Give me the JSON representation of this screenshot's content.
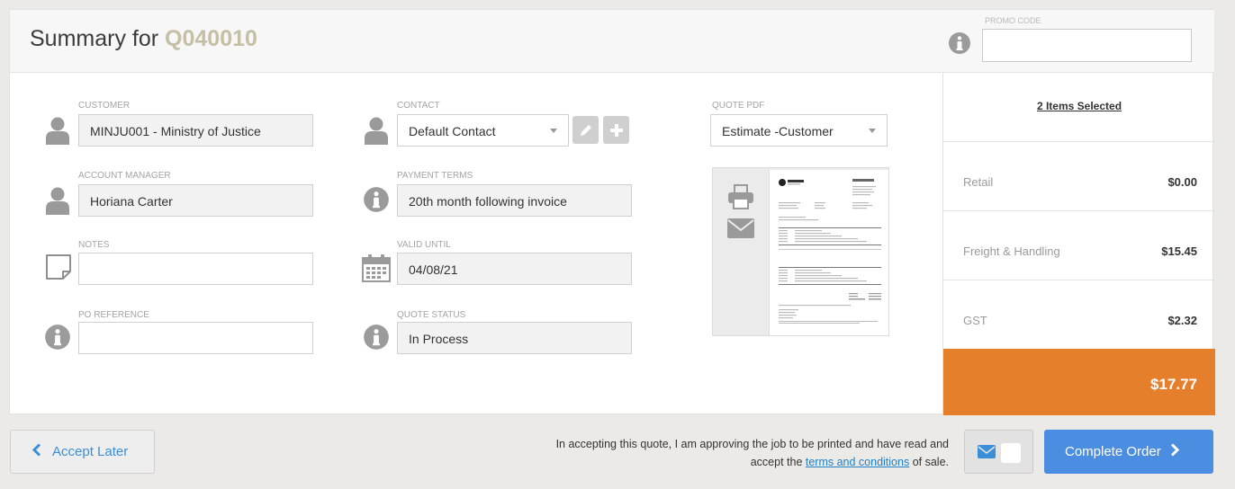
{
  "header": {
    "title_prefix": "Summary for",
    "quote_number": "Q040010",
    "promo_label": "PROMO CODE",
    "promo_value": ""
  },
  "fields": {
    "customer_label": "CUSTOMER",
    "customer_value": "MINJU001 - Ministry of Justice",
    "contact_label": "CONTACT",
    "contact_value": "Default Contact",
    "quote_pdf_label": "QUOTE PDF",
    "quote_pdf_value": "Estimate -Customer",
    "account_manager_label": "ACCOUNT MANAGER",
    "account_manager_value": "Horiana Carter",
    "payment_terms_label": "PAYMENT TERMS",
    "payment_terms_value": "20th month following invoice",
    "notes_label": "NOTES",
    "notes_value": "",
    "valid_until_label": "VALID UNTIL",
    "valid_until_value": "04/08/21",
    "po_reference_label": "PO REFERENCE",
    "po_reference_value": "",
    "quote_status_label": "QUOTE STATUS",
    "quote_status_value": "In Process"
  },
  "summary": {
    "items_selected": "2 Items Selected",
    "rows": [
      {
        "label": "Retail",
        "value": "$0.00"
      },
      {
        "label": "Freight & Handling",
        "value": "$15.45"
      },
      {
        "label": "GST",
        "value": "$2.32"
      }
    ],
    "total": "$17.77",
    "total_color": "#e67f2b"
  },
  "footer": {
    "accept_later": "Accept Later",
    "terms_before": "In accepting this quote, I am approving the job to be printed and have read and accept the ",
    "terms_link": "terms and conditions",
    "terms_after": " of sale.",
    "complete_order": "Complete Order"
  },
  "icons": {
    "person": "person-icon",
    "info": "info-icon",
    "note": "note-icon",
    "calendar": "calendar-icon",
    "edit": "pencil-icon",
    "add": "plus-icon",
    "print": "printer-icon",
    "email": "envelope-icon"
  }
}
